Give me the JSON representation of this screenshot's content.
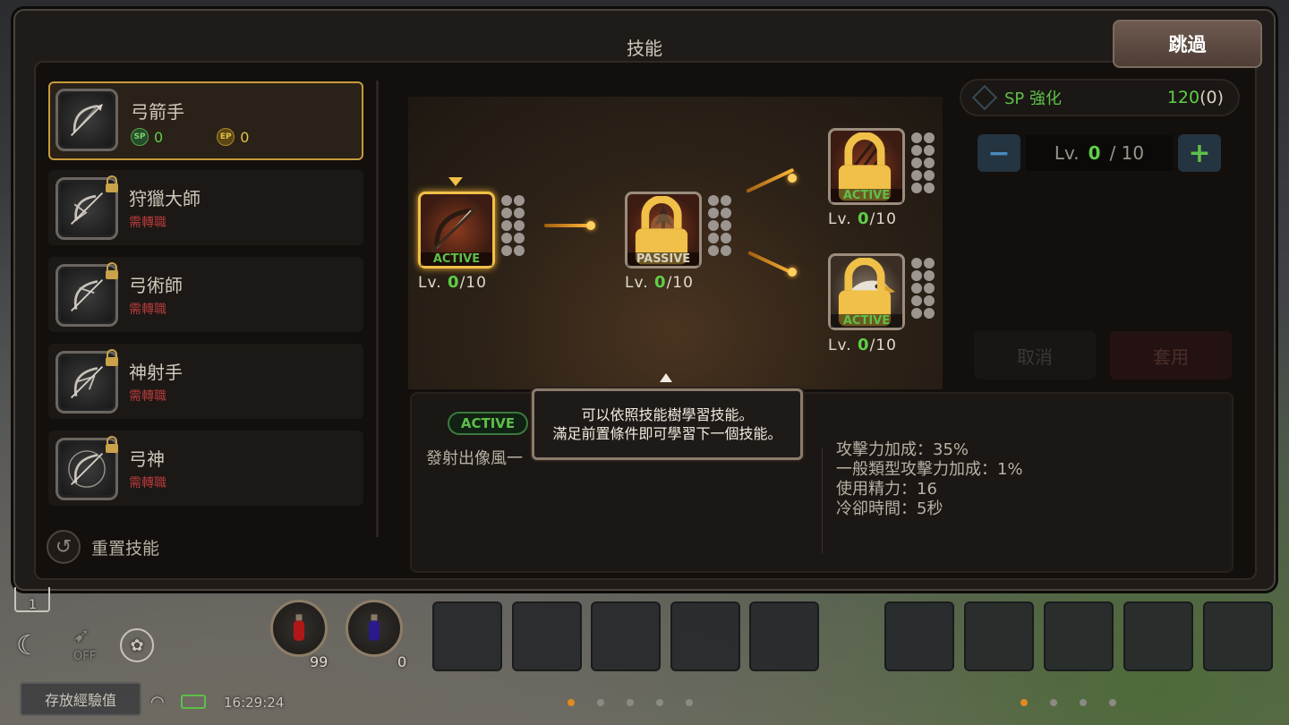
{
  "window": {
    "title": "技能",
    "skip_label": "跳過"
  },
  "jobs": [
    {
      "name": "弓箭手",
      "sp_label": "SP",
      "sp_value": "0",
      "ep_label": "EP",
      "ep_value": "0",
      "selected": true,
      "locked": false
    },
    {
      "name": "狩獵大師",
      "requirement": "需轉職",
      "locked": true
    },
    {
      "name": "弓術師",
      "requirement": "需轉職",
      "locked": true
    },
    {
      "name": "神射手",
      "requirement": "需轉職",
      "locked": true
    },
    {
      "name": "弓神",
      "requirement": "需轉職",
      "locked": true
    }
  ],
  "reset_label": "重置技能",
  "tree": {
    "nodes": [
      {
        "type": "ACTIVE",
        "lv_prefix": "Lv.",
        "level": "0",
        "max": "/10",
        "selected": true,
        "locked": false,
        "icon": "bow-icon"
      },
      {
        "type": "PASSIVE",
        "lv_prefix": "Lv.",
        "level": "0",
        "max": "/10",
        "selected": false,
        "locked": true,
        "icon": "arrowhead-icon"
      },
      {
        "type": "ACTIVE",
        "lv_prefix": "Lv.",
        "level": "0",
        "max": "/10",
        "selected": false,
        "locked": true,
        "icon": "triple-arrow-icon"
      },
      {
        "type": "ACTIVE",
        "lv_prefix": "Lv.",
        "level": "0",
        "max": "/10",
        "selected": false,
        "locked": true,
        "icon": "eagle-icon"
      }
    ]
  },
  "sp_panel": {
    "label": "SP 強化",
    "value": "120",
    "extra": "(0)"
  },
  "level_control": {
    "minus": "−",
    "lv_prefix": "Lv.",
    "level": "0",
    "max": "/ 10",
    "plus": "+"
  },
  "actions": {
    "cancel": "取消",
    "apply": "套用"
  },
  "detail": {
    "type_tag": "ACTIVE",
    "description": "發射出像風一",
    "stats": [
      "攻擊力加成：35%",
      "一般類型攻擊力加成：1%",
      "使用精力：16",
      "冷卻時間：5秒"
    ]
  },
  "tooltip": {
    "line1": "可以依照技能樹學習技能。",
    "line2": "滿足前置條件即可學習下一個技能。"
  },
  "hud": {
    "slot_number": "1",
    "auto_off": "OFF",
    "potion_red_count": "99",
    "potion_blue_count": "0",
    "save_exp_label": "存放經驗值",
    "time": "16:29:24"
  },
  "colors": {
    "accent_gold": "#f0c048",
    "green": "#5fcf48",
    "red_req": "#b33a3a"
  }
}
